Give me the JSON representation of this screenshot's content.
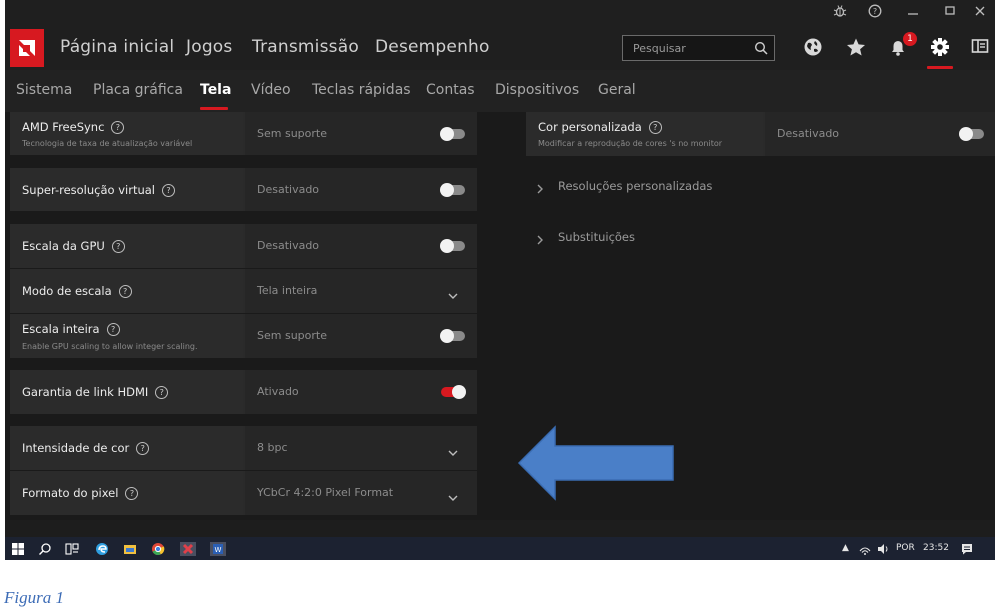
{
  "main_nav": {
    "items": [
      "Página inicial",
      "Jogos",
      "Transmissão",
      "Desempenho"
    ],
    "search_placeholder": "Pesquisar",
    "notification_count": "1",
    "icons": [
      "globe-icon",
      "star-icon",
      "bell-icon",
      "gear-icon",
      "sidebar-toggle-icon"
    ]
  },
  "title_bar": {
    "icons": [
      "bug-icon",
      "help-icon",
      "minimize-icon",
      "maximize-icon",
      "close-icon"
    ]
  },
  "sub_nav": {
    "items": [
      "Sistema",
      "Placa gráfica",
      "Tela",
      "Vídeo",
      "Teclas rápidas",
      "Contas",
      "Dispositivos",
      "Geral"
    ],
    "active": "Tela"
  },
  "settings": [
    {
      "title": "AMD FreeSync",
      "subtitle": "Tecnologia de taxa de atualização variável",
      "value": "Sem suporte",
      "control": "toggle",
      "state": "off"
    },
    {
      "title": "Super-resolução virtual",
      "value": "Desativado",
      "control": "toggle",
      "state": "off"
    },
    {
      "title": "Escala da GPU",
      "value": "Desativado",
      "control": "toggle",
      "state": "off"
    },
    {
      "title": "Modo de escala",
      "value": "Tela inteira",
      "control": "dropdown"
    },
    {
      "title": "Escala inteira",
      "subtitle": "Enable GPU scaling to allow integer scaling.",
      "value": "Sem suporte",
      "control": "toggle",
      "state": "off"
    },
    {
      "title": "Garantia de link HDMI",
      "value": "Ativado",
      "control": "toggle",
      "state": "on"
    },
    {
      "title": "Intensidade de cor",
      "value": "8 bpc",
      "control": "dropdown"
    },
    {
      "title": "Formato do pixel",
      "value": "YCbCr 4:2:0 Pixel Format",
      "control": "dropdown"
    }
  ],
  "right_settings": {
    "custom_color": {
      "title": "Cor personalizada",
      "subtitle": "Modificar a reprodução de cores 's no monitor",
      "value": "Desativado",
      "state": "off"
    },
    "expanders": [
      "Resoluções personalizadas",
      "Substituições"
    ]
  },
  "taskbar": {
    "language": "POR",
    "time": "23:52"
  },
  "colors": {
    "accent": "#d71920",
    "arrow": "#4a7fc8",
    "caption": "#3d6cb6"
  },
  "caption": "Figura 1"
}
